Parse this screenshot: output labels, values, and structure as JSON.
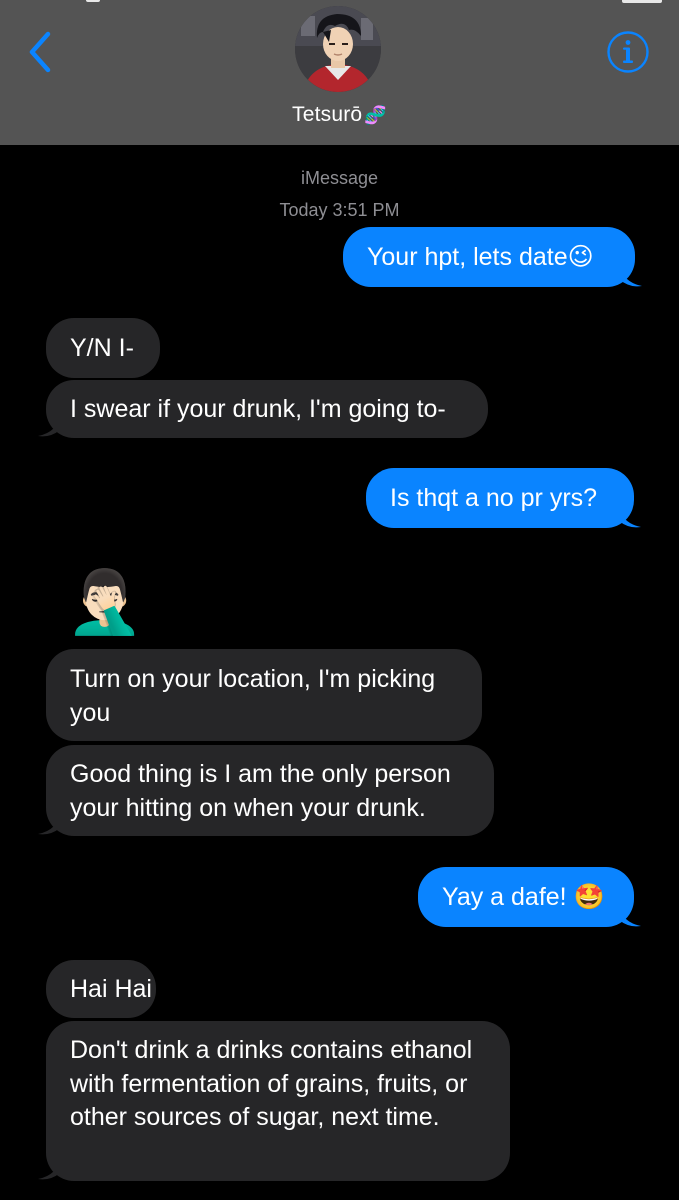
{
  "header": {
    "contact_name": "Tetsurō",
    "name_emoji": "🧬",
    "back_icon": "chevron-left-icon",
    "info_icon": "info-icon",
    "accent_color": "#0a84ff"
  },
  "thread": {
    "service": "iMessage",
    "timestamp": "Today 3:51 PM"
  },
  "messages": [
    {
      "from": "me",
      "text": "Your hpt, lets date😉"
    },
    {
      "from": "them",
      "text": "Y/N I-"
    },
    {
      "from": "them",
      "text": "I swear if your drunk, I'm going to-"
    },
    {
      "from": "me",
      "text": "Is thqt a no pr yrs?"
    },
    {
      "from": "them",
      "text": "🤦🏻‍♂️"
    },
    {
      "from": "them",
      "text": "Turn on your location, I'm picking you"
    },
    {
      "from": "them",
      "text": "Good thing is I am the only person your hitting on when your drunk."
    },
    {
      "from": "me",
      "text": "Yay a dafe! 🤩"
    },
    {
      "from": "them",
      "text": "Hai Hai"
    },
    {
      "from": "them",
      "text": "Don't drink a drinks contains ethanol with fermentation of grains, fruits, or other sources of sugar, next time."
    }
  ],
  "colors": {
    "sent_bubble": "#0a84ff",
    "received_bubble": "#262628",
    "header_bg": "#545454",
    "meta_text": "#8e8e93"
  }
}
